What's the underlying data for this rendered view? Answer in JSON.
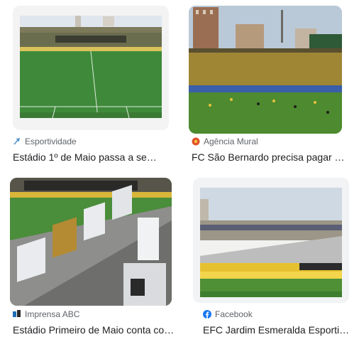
{
  "results": [
    {
      "source": "Esportividade",
      "source_icon": "esportividade-favicon",
      "title": "Estádio 1º de Maio passa a se…"
    },
    {
      "source": "Agência Mural",
      "source_icon": "agencia-mural-favicon",
      "title": "FC São Bernardo precisa pagar …"
    },
    {
      "source": "Imprensa ABC",
      "source_icon": "imprensa-abc-favicon",
      "title": "Estádio Primeiro de Maio conta co…"
    },
    {
      "source": "Facebook",
      "source_icon": "facebook-favicon",
      "title": "EFC Jardim Esmeralda Esporti…"
    }
  ],
  "colors": {
    "pitch_green": "#3f8a3a",
    "stand_yellow": "#e0b52a",
    "facebook_blue": "#1877f2"
  }
}
